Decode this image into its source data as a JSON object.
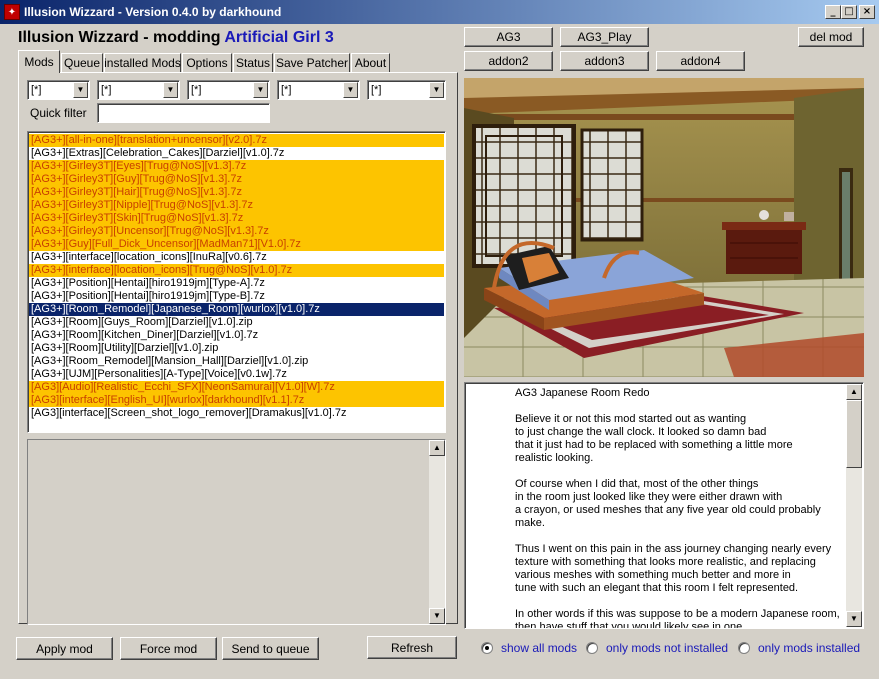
{
  "window": {
    "title": "Illusion Wizzard - Version 0.4.0 by darkhound",
    "minimize": "_",
    "maximize": "□",
    "close": "×"
  },
  "heading": {
    "prefix": "Illusion Wizzard - modding ",
    "game": "Artificial Girl 3"
  },
  "top_buttons": {
    "ag3": "AG3",
    "ag3_play": "AG3_Play",
    "del_mod": "del mod",
    "addon2": "addon2",
    "addon3": "addon3",
    "addon4": "addon4"
  },
  "tabs": [
    "Mods",
    "Queue",
    "installed Mods",
    "Options",
    "Status",
    "Save Patcher",
    "About"
  ],
  "filters": [
    "[*]",
    "[*]",
    "[*]",
    "[*]",
    "[*]"
  ],
  "quick_filter": {
    "label": "Quick filter",
    "value": ""
  },
  "mods": [
    {
      "name": "[AG3+][all-in-one][translation+uncensor][v2.0].7z",
      "state": "installed"
    },
    {
      "name": "[AG3+][Extras][Celebration_Cakes][Darziel][v1.0].7z",
      "state": "normal"
    },
    {
      "name": "[AG3+][Girley3T][Eyes][Trug@NoS][v1.3].7z",
      "state": "installed"
    },
    {
      "name": "[AG3+][Girley3T][Guy][Trug@NoS][v1.3].7z",
      "state": "installed"
    },
    {
      "name": "[AG3+][Girley3T][Hair][Trug@NoS][v1.3].7z",
      "state": "installed"
    },
    {
      "name": "[AG3+][Girley3T][Nipple][Trug@NoS][v1.3].7z",
      "state": "installed"
    },
    {
      "name": "[AG3+][Girley3T][Skin][Trug@NoS][v1.3].7z",
      "state": "installed"
    },
    {
      "name": "[AG3+][Girley3T][Uncensor][Trug@NoS][v1.3].7z",
      "state": "installed"
    },
    {
      "name": "[AG3+][Guy][Full_Dick_Uncensor][MadMan71][V1.0].7z",
      "state": "installed"
    },
    {
      "name": "[AG3+][interface][location_icons][InuRa][v0.6].7z",
      "state": "normal"
    },
    {
      "name": "[AG3+][interface][location_icons][Trug@NoS][v1.0].7z",
      "state": "installed"
    },
    {
      "name": "[AG3+][Position][Hentai][hiro1919jm][Type-A].7z",
      "state": "normal"
    },
    {
      "name": "[AG3+][Position][Hentai][hiro1919jm][Type-B].7z",
      "state": "normal"
    },
    {
      "name": "[AG3+][Room_Remodel][Japanese_Room][wurlox][v1.0].7z",
      "state": "selected"
    },
    {
      "name": "[AG3+][Room][Guys_Room][Darziel][v1.0].zip",
      "state": "normal"
    },
    {
      "name": "[AG3+][Room][Kitchen_Diner][Darziel][v1.0].7z",
      "state": "normal"
    },
    {
      "name": "[AG3+][Room][Utility][Darziel][v1.0].zip",
      "state": "normal"
    },
    {
      "name": "[AG3+][Room_Remodel][Mansion_Hall][Darziel][v1.0].zip",
      "state": "normal"
    },
    {
      "name": "[AG3+][UJM][Personalities][A-Type][Voice][v0.1w].7z",
      "state": "normal"
    },
    {
      "name": "[AG3][Audio][Realistic_Ecchi_SFX][NeonSamurai][V1.0][W].7z",
      "state": "installed"
    },
    {
      "name": "[AG3][interface][English_UI][wurlox][darkhound][v1.1].7z",
      "state": "installed"
    },
    {
      "name": "[AG3][interface][Screen_shot_logo_remover][Dramakus][v1.0].7z",
      "state": "normal"
    }
  ],
  "description": {
    "title": "AG3 Japanese Room Redo",
    "paragraphs": [
      "Believe it or not this mod started out as wanting\nto just change the wall clock. It looked so damn bad\nthat it just had to be replaced with something a little more\nrealistic looking.",
      "Of course when I did that, most of the other things\nin the room just looked like they were either drawn with\na crayon, or used meshes that any five year old could probably make.",
      "Thus I went on this pain in the ass journey changing nearly every\ntexture with something that looks more realistic, and replacing\nvarious meshes with something much better and more in\ntune with such an elegant that this room I felt represented.",
      "In other words if this was suppose to be a modern Japanese room,\nthen have stuff that you would likely see in one."
    ]
  },
  "bottom_buttons": {
    "apply": "Apply mod",
    "force": "Force mod",
    "send_queue": "Send to queue",
    "refresh": "Refresh"
  },
  "radios": [
    {
      "label": "show all mods",
      "checked": true
    },
    {
      "label": "only mods not installed",
      "checked": false
    },
    {
      "label": "only mods installed",
      "checked": false
    }
  ]
}
